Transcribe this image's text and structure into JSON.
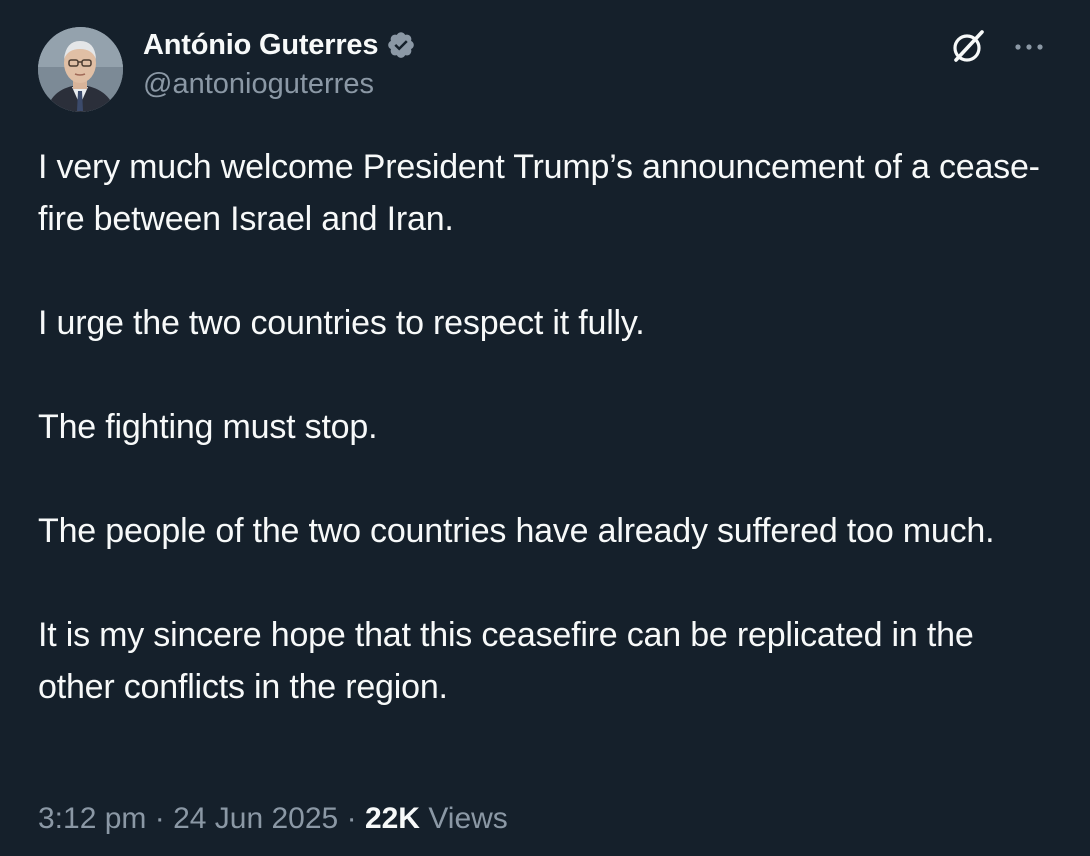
{
  "author": {
    "display_name": "António Guterres",
    "handle": "@antonioguterres",
    "verified": true,
    "verified_color": "#8b98a5"
  },
  "actions": {
    "grok_icon": "grok-icon",
    "more_icon": "more-options-icon"
  },
  "tweet": {
    "paragraphs": [
      "I very much welcome President Trump’s announcement of a cease-fire between Israel and Iran.",
      "I urge the two countries to respect it fully.",
      "The fighting must stop.",
      "The people of the two countries have already suffered too much.",
      "It is my sincere hope that this ceasefire can be replicated in the other conflicts in the region."
    ]
  },
  "meta": {
    "time": "3:12 pm",
    "separator": "·",
    "date": "24 Jun 2025",
    "views_count": "22K",
    "views_label": "Views"
  },
  "colors": {
    "background": "#15202b",
    "text_primary": "#f7f9f9",
    "text_secondary": "#8b98a5"
  }
}
